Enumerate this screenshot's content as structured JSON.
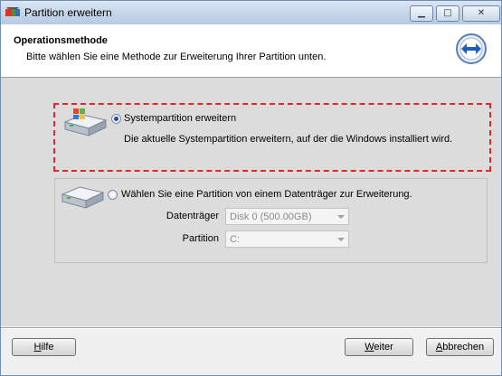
{
  "window": {
    "title": "Partition erweitern",
    "controls": {
      "minimize": "▁",
      "maximize": "□",
      "close": "✕"
    }
  },
  "header": {
    "title": "Operationsmethode",
    "subtitle": "Bitte wählen Sie eine Methode zur Erweiterung Ihrer Partition unten."
  },
  "options": {
    "system": {
      "label": "Systempartition erweitern",
      "description": "Die aktuelle Systempartition erweitern, auf der die Windows installiert wird.",
      "selected": true
    },
    "data_disk": {
      "label": "Wählen Sie eine Partition von einem Datenträger zur Erweiterung.",
      "selected": false,
      "fields": {
        "disk_label": "Datenträger",
        "disk_value": "Disk 0 (500.00GB)",
        "partition_label": "Partition",
        "partition_value": "C:"
      }
    }
  },
  "buttons": {
    "help_accel": "H",
    "help_rest": "ilfe",
    "next_accel": "W",
    "next_rest": "eiter",
    "cancel_accel": "A",
    "cancel_rest": "bbrechen"
  },
  "colors": {
    "highlight_border": "#e32727",
    "radio_dot": "#1d4f9a"
  },
  "icons": {
    "app": "partition-app-icon",
    "header": "expand-arrows-icon",
    "drive": "hard-drive-icon",
    "windows_drive": "windows-system-drive-icon"
  }
}
